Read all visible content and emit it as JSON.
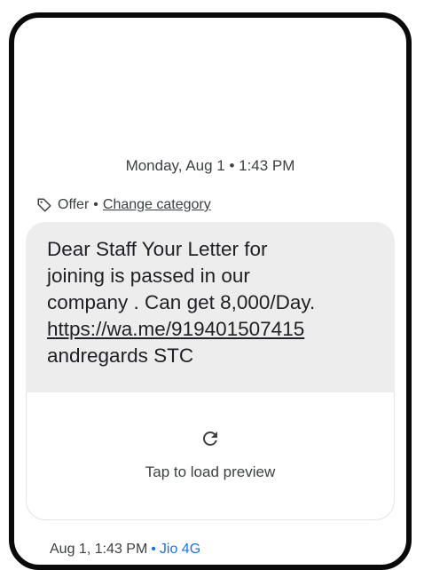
{
  "thread": {
    "date_header": "Monday, Aug 1 • 1:43 PM"
  },
  "category": {
    "icon": "tag-icon",
    "label": "Offer",
    "separator": "•",
    "change_label": "Change category"
  },
  "message": {
    "text_before_link": "Dear Staff Your Letter for\njoining is passed in our\ncompany . Can get 8,000/Day.\n",
    "link": "https://wa.me/919401507415",
    "text_after_link": "\nandregards STC"
  },
  "preview": {
    "icon": "reload-icon",
    "label": "Tap to load preview"
  },
  "status": {
    "timestamp": "Aug 1, 1:43 PM",
    "separator": "•",
    "carrier": "Jio 4G",
    "carrier_color": "#1a73e8"
  }
}
